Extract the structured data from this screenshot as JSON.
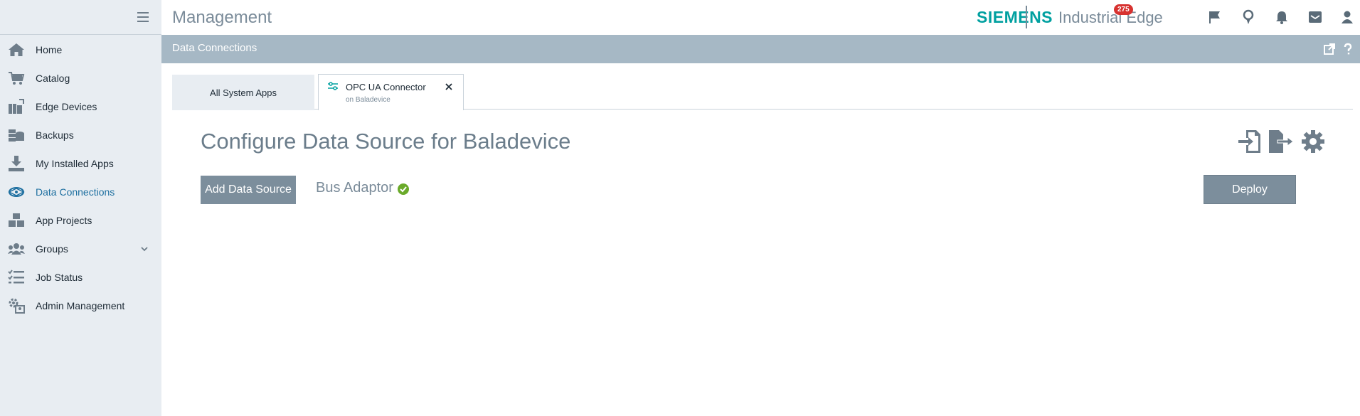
{
  "header": {
    "app_title": "Management",
    "brand_name": "SIEMENS",
    "brand_product": "Industrial Edge",
    "notification_count": "275",
    "brand_color": "#00a0a0"
  },
  "sidebar": {
    "items": [
      {
        "label": "Home",
        "icon": "home-icon"
      },
      {
        "label": "Catalog",
        "icon": "cart-icon"
      },
      {
        "label": "Edge Devices",
        "icon": "devices-icon"
      },
      {
        "label": "Backups",
        "icon": "backup-icon"
      },
      {
        "label": "My Installed Apps",
        "icon": "download-icon"
      },
      {
        "label": "Data Connections",
        "icon": "connection-icon",
        "active": true
      },
      {
        "label": "App Projects",
        "icon": "boxes-icon"
      },
      {
        "label": "Groups",
        "icon": "users-icon"
      },
      {
        "label": "Job Status",
        "icon": "list-icon"
      },
      {
        "label": "Admin Management",
        "icon": "admin-gear-icon"
      }
    ]
  },
  "subheader": {
    "title": "Data Connections"
  },
  "tabs": {
    "all_label": "All System Apps",
    "opc_title": "OPC UA Connector",
    "opc_subtitle": "on Baladevice"
  },
  "main": {
    "heading": "Configure Data Source for Baladevice",
    "add_button": "Add Data Source",
    "adaptor_label": "Bus Adaptor",
    "deploy_button": "Deploy",
    "accent_color": "#7c8e9c",
    "status_color": "#6aaa2a"
  }
}
